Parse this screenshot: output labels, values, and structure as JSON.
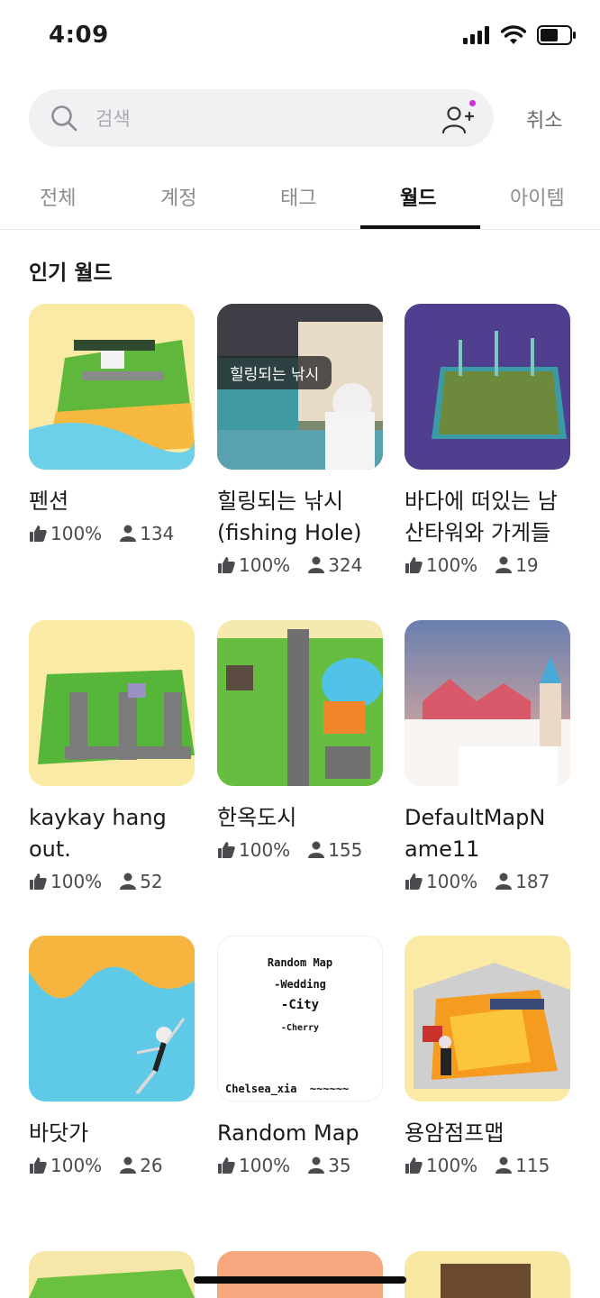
{
  "status_bar": {
    "time": "4:09"
  },
  "search": {
    "placeholder": "검색",
    "value": "",
    "cancel_label": "취소"
  },
  "tabs": [
    {
      "label": "전체",
      "active": false
    },
    {
      "label": "계정",
      "active": false
    },
    {
      "label": "태그",
      "active": false
    },
    {
      "label": "월드",
      "active": true
    },
    {
      "label": "아이템",
      "active": false
    }
  ],
  "section": {
    "title": "인기 월드"
  },
  "worlds": [
    {
      "title": "펜션",
      "like": "100%",
      "users": "134",
      "thumb_caption": ""
    },
    {
      "title": "힐링되는 낚시\n(fishing Hole)",
      "like": "100%",
      "users": "324",
      "thumb_caption": "힐링되는 낚시"
    },
    {
      "title": "바다에 떠있는 남\n산타워와 가게들",
      "like": "100%",
      "users": "19",
      "thumb_caption": ""
    },
    {
      "title": "kaykay hang\nout.",
      "like": "100%",
      "users": "52",
      "thumb_caption": ""
    },
    {
      "title": "한옥도시",
      "like": "100%",
      "users": "155",
      "thumb_caption": ""
    },
    {
      "title": "DefaultMapN\name11",
      "like": "100%",
      "users": "187",
      "thumb_caption": ""
    },
    {
      "title": "바닷가",
      "like": "100%",
      "users": "26",
      "thumb_caption": ""
    },
    {
      "title": "Random Map",
      "like": "100%",
      "users": "35",
      "thumb_text": [
        "Random Map",
        "-Wedding",
        "-City",
        "-Cherry",
        "Chelsea_xia  ~~~~~~"
      ]
    },
    {
      "title": "용암점프맵",
      "like": "100%",
      "users": "115",
      "thumb_caption": ""
    }
  ],
  "colors": {
    "accent_dot": "#d12ee0",
    "thumb_yellow": "#faeaa6",
    "thumb_purple": "#4f3f8e"
  }
}
